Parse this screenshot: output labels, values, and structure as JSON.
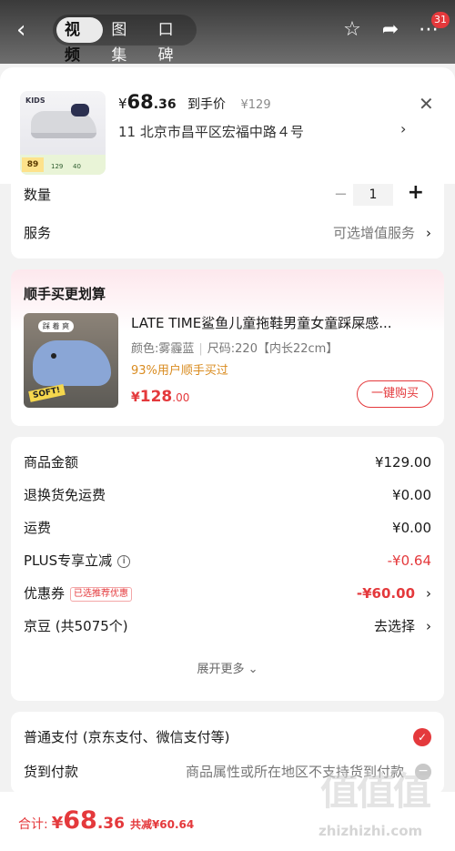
{
  "top": {
    "tabs": [
      "视频",
      "图集",
      "口碑"
    ],
    "badge": "31"
  },
  "header": {
    "price_symbol": "¥",
    "price_int": "68",
    "price_dec": ".36",
    "price_label": "到手价",
    "orig_price": "¥129",
    "address": "11  北京市昌平区宏福中路４号",
    "thumb_brand": "KIDS",
    "thumb_score": "89",
    "thumb_v1": "129",
    "thumb_v2": "40"
  },
  "quantity": {
    "label": "数量",
    "value": "1"
  },
  "service": {
    "label": "服务",
    "value": "可选增值服务"
  },
  "combo": {
    "title": "顺手买更划算",
    "name": "LATE TIME鲨鱼儿童拖鞋男童女童踩屎感...",
    "color": "颜色:雾霾蓝",
    "size": "尺码:220【内长22cm】",
    "percent": "93%用户顺手买过",
    "price_symbol": "¥",
    "price_int": "128",
    "price_dec": ".00",
    "buy_label": "一键购买",
    "img_bubble": "踩 着 爽",
    "img_tag": "SOFT!"
  },
  "summary": {
    "rows": [
      {
        "k": "商品金额",
        "v": "¥129.00"
      },
      {
        "k": "退换货免运费",
        "v": "¥0.00"
      },
      {
        "k": "运费",
        "v": "¥0.00"
      },
      {
        "k": "PLUS专享立减",
        "v": "-¥0.64"
      },
      {
        "k": "优惠券",
        "v": "-¥60.00"
      },
      {
        "k": "京豆 (共5075个)",
        "v": "去选择"
      }
    ],
    "coupon_tag": "已选推荐优惠",
    "more": "展开更多"
  },
  "payment": {
    "normal": "普通支付 (京东支付、微信支付等)",
    "cod_label": "货到付款",
    "cod_note": "商品属性或所在地区不支持货到付款"
  },
  "bottom": {
    "total_label": "合计:",
    "symbol": "¥",
    "int": "68",
    "dec": ".36",
    "saved": "共减¥60.64"
  },
  "watermark": {
    "big": "值值值",
    "small": "zhizhizhi.com"
  },
  "colors": {
    "accent": "#e4393c",
    "orange": "#d98b1f"
  }
}
